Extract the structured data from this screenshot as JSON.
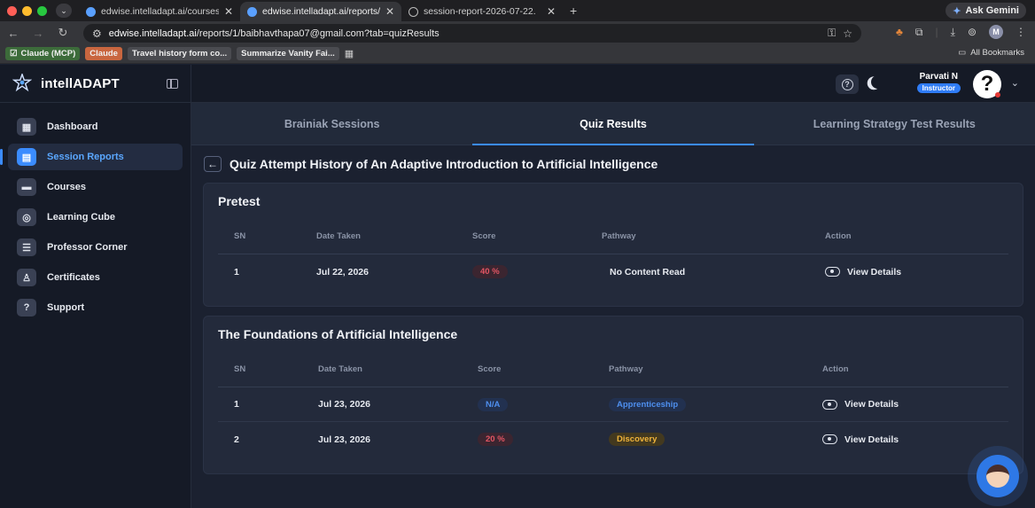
{
  "browser": {
    "tabs": [
      {
        "label": "edwise.intelladapt.ai/courses",
        "active": false
      },
      {
        "label": "edwise.intelladapt.ai/reports/",
        "active": true
      },
      {
        "label": "session-report-2026-07-22.",
        "active": false
      }
    ],
    "ask_gemini": "Ask Gemini",
    "url_host": "edwise.intelladapt.ai",
    "url_path": "/reports/1/baibhavthapa07@gmail.com?tab=quizResults",
    "profile_initial": "M",
    "bookmarks": [
      "Claude (MCP)",
      "Claude",
      "Travel history form co...",
      "Summarize Vanity Fai..."
    ],
    "all_bookmarks": "All Bookmarks"
  },
  "sidebar": {
    "brand": "intellADAPT",
    "items": [
      {
        "label": "Dashboard",
        "icon": "dashboard-icon",
        "glyph": "▦",
        "active": false
      },
      {
        "label": "Session Reports",
        "icon": "report-icon",
        "glyph": "▤",
        "active": true
      },
      {
        "label": "Courses",
        "icon": "courses-icon",
        "glyph": "▬",
        "active": false
      },
      {
        "label": "Learning Cube",
        "icon": "cube-icon",
        "glyph": "◎",
        "active": false
      },
      {
        "label": "Professor Corner",
        "icon": "chart-icon",
        "glyph": "☰",
        "active": false
      },
      {
        "label": "Certificates",
        "icon": "certificate-icon",
        "glyph": "♙",
        "active": false
      },
      {
        "label": "Support",
        "icon": "support-icon",
        "glyph": "?",
        "active": false
      }
    ]
  },
  "user": {
    "name": "Parvati N",
    "role": "Instructor",
    "avatar_glyph": "?"
  },
  "page_tabs": [
    {
      "label": "Brainiak Sessions",
      "active": false
    },
    {
      "label": "Quiz Results",
      "active": true
    },
    {
      "label": "Learning Strategy Test Results",
      "active": false
    }
  ],
  "page_title": "Quiz Attempt History of An Adaptive Introduction to Artificial Intelligence",
  "table_headers": {
    "sn": "SN",
    "date": "Date Taken",
    "score": "Score",
    "pathway": "Pathway",
    "action": "Action"
  },
  "sections": [
    {
      "title": "Pretest",
      "rows": [
        {
          "sn": "1",
          "date": "Jul 22, 2026",
          "score": "40 %",
          "pathway": "No Content Read",
          "action": "View Details"
        }
      ]
    },
    {
      "title": "The Foundations of Artificial Intelligence",
      "rows": [
        {
          "sn": "1",
          "date": "Jul 23, 2026",
          "score": "N/A",
          "pathway": "Apprenticeship",
          "action": "View Details"
        },
        {
          "sn": "2",
          "date": "Jul 23, 2026",
          "score": "20 %",
          "pathway": "Discovery",
          "action": "View Details"
        }
      ]
    }
  ],
  "colors": {
    "accent": "#3b8cff",
    "score_low": "#e25563",
    "na": "#4e8fee",
    "discovery": "#f0b43a",
    "sidebar_bg": "#151a26",
    "page_bg": "#1b2130"
  }
}
